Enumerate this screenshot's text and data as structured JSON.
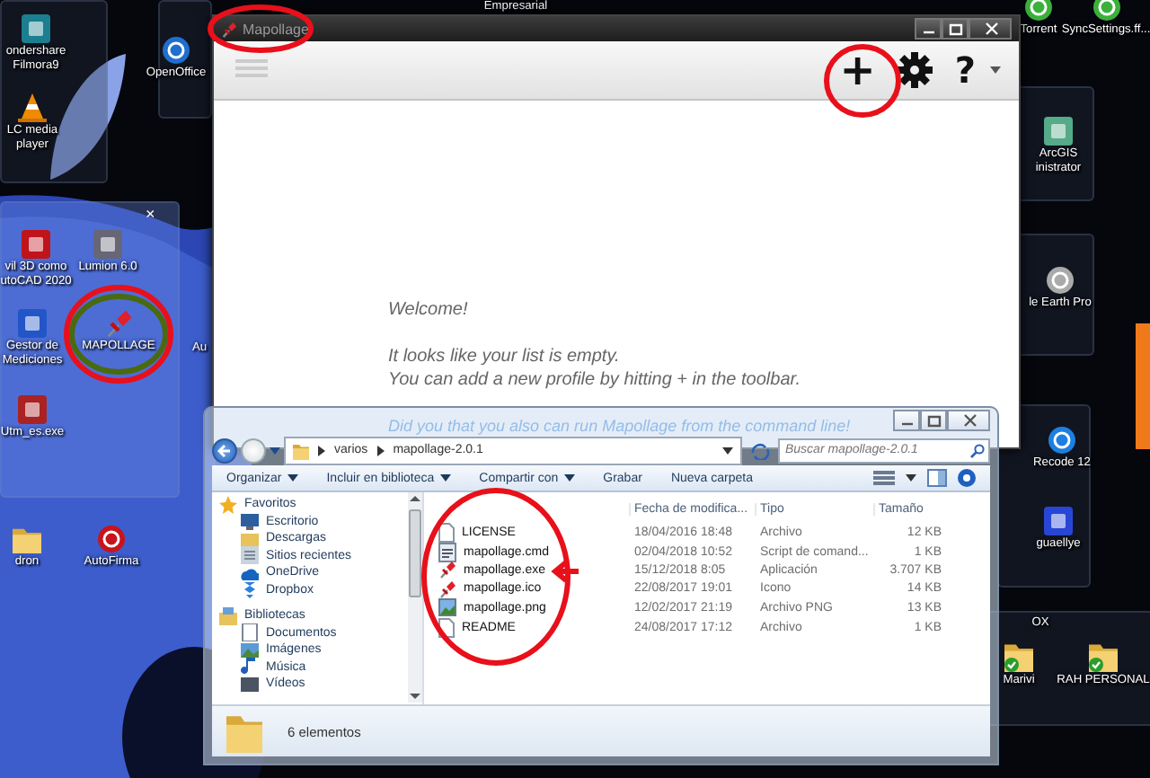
{
  "desktop_icons": [
    {
      "label": "ondershare Filmora9",
      "kind": "tile"
    },
    {
      "label": "LC media player",
      "kind": "cone"
    },
    {
      "label": "vil 3D como utoCAD 2020",
      "kind": "tile"
    },
    {
      "label": "Lumion 6.0",
      "kind": "tile"
    },
    {
      "label": "Gestor de Mediciones",
      "kind": "tile"
    },
    {
      "label": "MAPOLLAGE",
      "kind": "pin"
    },
    {
      "label": "Utm_es.exe",
      "kind": "tile"
    },
    {
      "label": "dron",
      "kind": "folder"
    },
    {
      "label": "AutoFirma",
      "kind": "circle"
    },
    {
      "label": "OpenOffice",
      "kind": "circle"
    },
    {
      "label": "Empresarial",
      "kind": "none"
    },
    {
      "label": "Au",
      "kind": "none"
    },
    {
      "label": "Torrent",
      "kind": "circle"
    },
    {
      "label": "SyncSettings.ff...",
      "kind": "circle"
    },
    {
      "label": "ArcGIS inistrator",
      "kind": "tile"
    },
    {
      "label": "le Earth Pro",
      "kind": "circle"
    },
    {
      "label": "Recode 12",
      "kind": "circle"
    },
    {
      "label": "guaellye",
      "kind": "tile"
    },
    {
      "label": "OX",
      "kind": "none"
    },
    {
      "label": "Marivi",
      "kind": "synced-folder"
    },
    {
      "label": "RAH PERSONAL",
      "kind": "synced-folder"
    }
  ],
  "fence": {
    "close": "×"
  },
  "mapollage_window": {
    "title": "Mapollage",
    "add_symbol": "+",
    "help_symbol": "?",
    "welcome": "Welcome!",
    "message_lines": [
      "It looks like your list is empty.",
      "You can add a new profile by hitting + in the toolbar."
    ],
    "tip": "Did you that you also can run Mapollage from the command line!"
  },
  "explorer": {
    "path": [
      "varios",
      "mapollage-2.0.1"
    ],
    "search_placeholder": "Buscar mapollage-2.0.1",
    "commands": [
      {
        "label": "Organizar",
        "dropdown": true
      },
      {
        "label": "Incluir en biblioteca",
        "dropdown": true
      },
      {
        "label": "Compartir con",
        "dropdown": true
      },
      {
        "label": "Grabar",
        "dropdown": false
      },
      {
        "label": "Nueva carpeta",
        "dropdown": false
      }
    ],
    "nav": [
      {
        "label": "Favoritos",
        "kind": "star",
        "children": [
          {
            "label": "Escritorio",
            "kind": "desktop"
          },
          {
            "label": "Descargas",
            "kind": "folder"
          },
          {
            "label": "Sitios recientes",
            "kind": "recent"
          },
          {
            "label": "OneDrive",
            "kind": "cloud"
          },
          {
            "label": "Dropbox",
            "kind": "dropbox"
          }
        ]
      },
      {
        "label": "Bibliotecas",
        "kind": "library",
        "children": [
          {
            "label": "Documentos",
            "kind": "document"
          },
          {
            "label": "Imágenes",
            "kind": "image"
          },
          {
            "label": "Música",
            "kind": "music"
          },
          {
            "label": "Vídeos",
            "kind": "video"
          }
        ]
      }
    ],
    "columns": [
      "Fecha de modifica...",
      "Tipo",
      "Tamaño"
    ],
    "files": [
      {
        "name": "LICENSE",
        "kind": "document",
        "modified": "18/04/2016 18:48",
        "type": "Archivo",
        "size": "12 KB"
      },
      {
        "name": "mapollage.cmd",
        "kind": "script",
        "modified": "02/04/2018 10:52",
        "type": "Script de comand...",
        "size": "1 KB"
      },
      {
        "name": "mapollage.exe",
        "kind": "pin",
        "modified": "15/12/2018 8:05",
        "type": "Aplicación",
        "size": "3.707 KB"
      },
      {
        "name": "mapollage.ico",
        "kind": "pin",
        "modified": "22/08/2017 19:01",
        "type": "Icono",
        "size": "14 KB"
      },
      {
        "name": "mapollage.png",
        "kind": "image",
        "modified": "12/02/2017 21:19",
        "type": "Archivo PNG",
        "size": "13 KB"
      },
      {
        "name": "README",
        "kind": "document",
        "modified": "24/08/2017 17:12",
        "type": "Archivo",
        "size": "1 KB"
      }
    ],
    "status": "6 elementos"
  }
}
